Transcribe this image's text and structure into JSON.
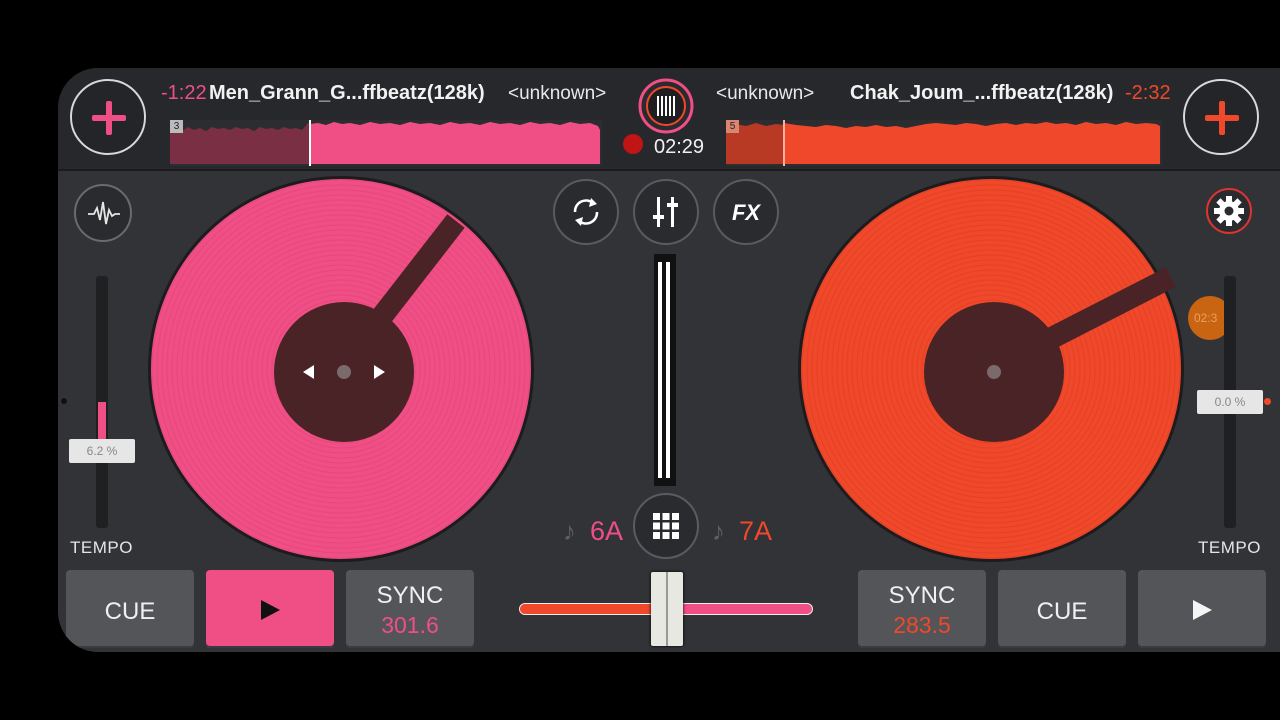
{
  "colors": {
    "deck_a": "#ef4f85",
    "deck_b": "#f0482a",
    "background": "#323337",
    "topbar": "#27282b"
  },
  "deck_a": {
    "time_remaining": "-1:22",
    "title": "Men_Grann_G...ffbeatz(128k)",
    "artist": "<unknown>",
    "hot_cue": "3",
    "tempo": "6.2 %",
    "tempo_label": "TEMPO",
    "key": "6A",
    "cue_label": "CUE",
    "sync_label": "SYNC",
    "bpm": "301.6",
    "icons": {
      "add": "plus-icon",
      "analyzer": "waveform-icon",
      "play": "play-icon",
      "prev": "arrow-left-icon",
      "next": "arrow-right-icon",
      "key": "music-note-icon"
    }
  },
  "deck_b": {
    "time_remaining": "-2:32",
    "title": "Chak_Joum_...ffbeatz(128k)",
    "artist": "<unknown>",
    "hot_cue": "5",
    "tempo": "0.0 %",
    "tempo_label": "TEMPO",
    "key": "7A",
    "cue_label": "CUE",
    "sync_label": "SYNC",
    "bpm": "283.5",
    "side_badge": "02:3",
    "icons": {
      "add": "plus-icon",
      "settings": "gear-icon",
      "play": "play-icon",
      "key": "music-note-icon"
    }
  },
  "center": {
    "record_time": "02:29",
    "fx_label": "FX",
    "icons": {
      "record": "record-icon",
      "loop": "loop-icon",
      "mixer": "mixer-sliders-icon",
      "fx": "fx-icon",
      "grid": "grid-icon",
      "logo": "vinyl-logo-icon"
    }
  }
}
